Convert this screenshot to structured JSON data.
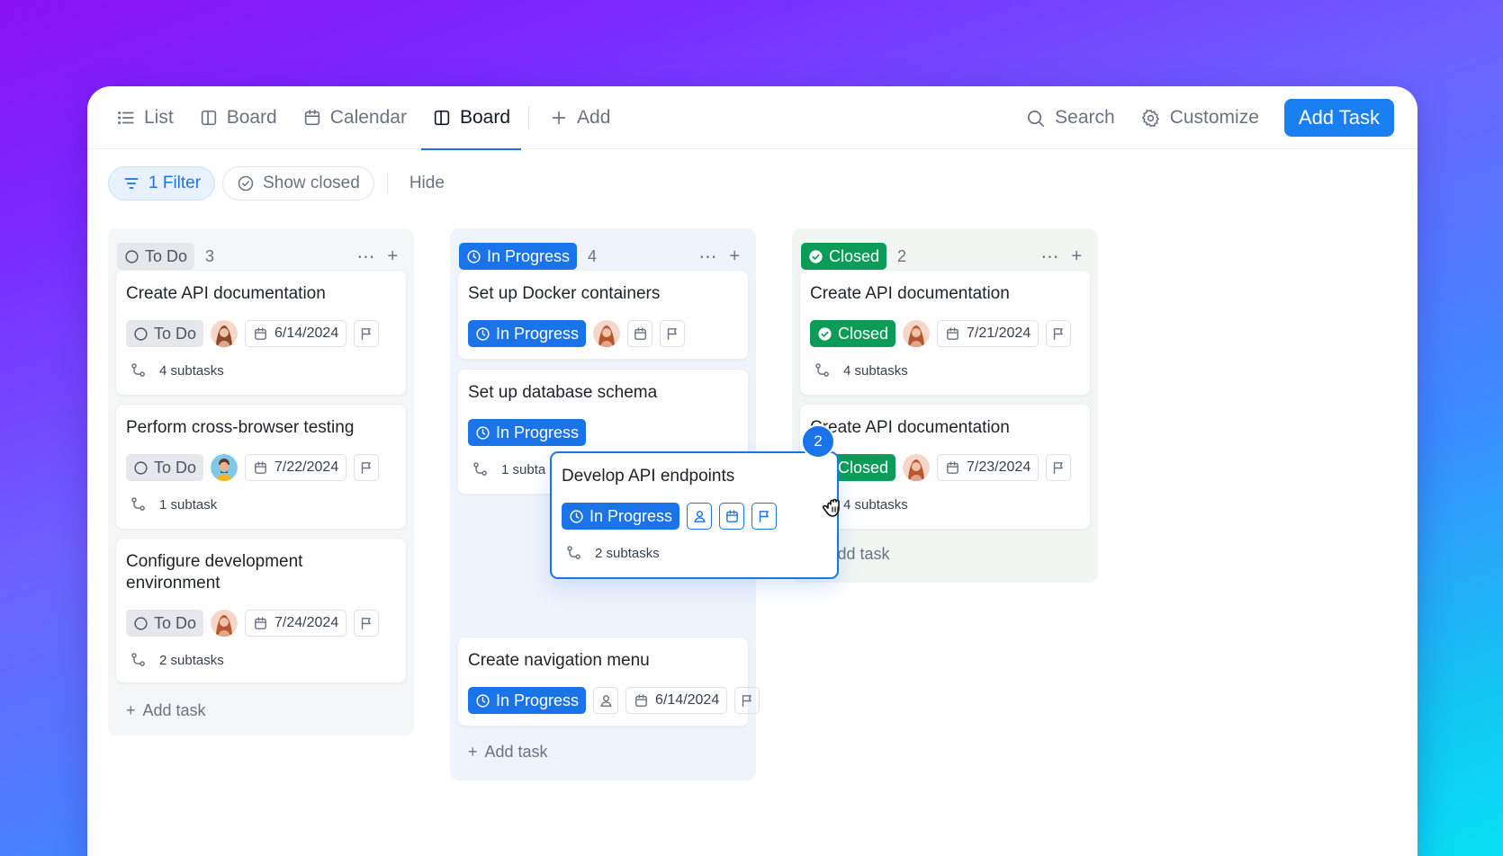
{
  "topbar": {
    "tabs": [
      {
        "label": "List",
        "icon": "list-icon"
      },
      {
        "label": "Board",
        "icon": "board-icon"
      },
      {
        "label": "Calendar",
        "icon": "calendar-icon"
      },
      {
        "label": "Board",
        "icon": "board-icon",
        "active": true
      }
    ],
    "add_label": "Add",
    "search_label": "Search",
    "customize_label": "Customize",
    "add_task_label": "Add Task"
  },
  "filters": {
    "filter_label": "1 Filter",
    "show_closed_label": "Show closed",
    "hide_label": "Hide"
  },
  "colors": {
    "accent": "#1a73e8",
    "closed_green": "#0d9b58",
    "todo_gray": "#e6e7ea"
  },
  "columns": {
    "todo": {
      "status": "To Do",
      "count": "3",
      "add_task_label": "Add task",
      "cards": [
        {
          "title": "Create API documentation",
          "status": "To Do",
          "date": "6/14/2024",
          "subtasks": "4 subtasks"
        },
        {
          "title": "Perform cross-browser testing",
          "status": "To Do",
          "date": "7/22/2024",
          "subtasks": "1 subtask"
        },
        {
          "title": "Configure development environment",
          "status": "To Do",
          "date": "7/24/2024",
          "subtasks": "2 subtasks"
        }
      ]
    },
    "in_progress": {
      "status": "In Progress",
      "count": "4",
      "add_task_label": "Add task",
      "cards": [
        {
          "title": "Set up Docker containers",
          "status": "In Progress"
        },
        {
          "title": "Set up database schema",
          "status": "In Progress",
          "subtasks": "1 subta"
        },
        {
          "title": "Create navigation menu",
          "status": "In Progress",
          "date": "6/14/2024"
        }
      ]
    },
    "closed": {
      "status": "Closed",
      "count": "2",
      "add_task_label": "Add task",
      "cards": [
        {
          "title": "Create API documentation",
          "status": "Closed",
          "date": "7/21/2024",
          "subtasks": "4 subtasks"
        },
        {
          "title": "Create API documentation",
          "status": "Closed",
          "date": "7/23/2024",
          "subtasks": "4 subtasks"
        }
      ]
    }
  },
  "drag": {
    "title": "Develop API endpoints",
    "status": "In Progress",
    "subtasks": "2 subtasks",
    "count_badge": "2"
  }
}
